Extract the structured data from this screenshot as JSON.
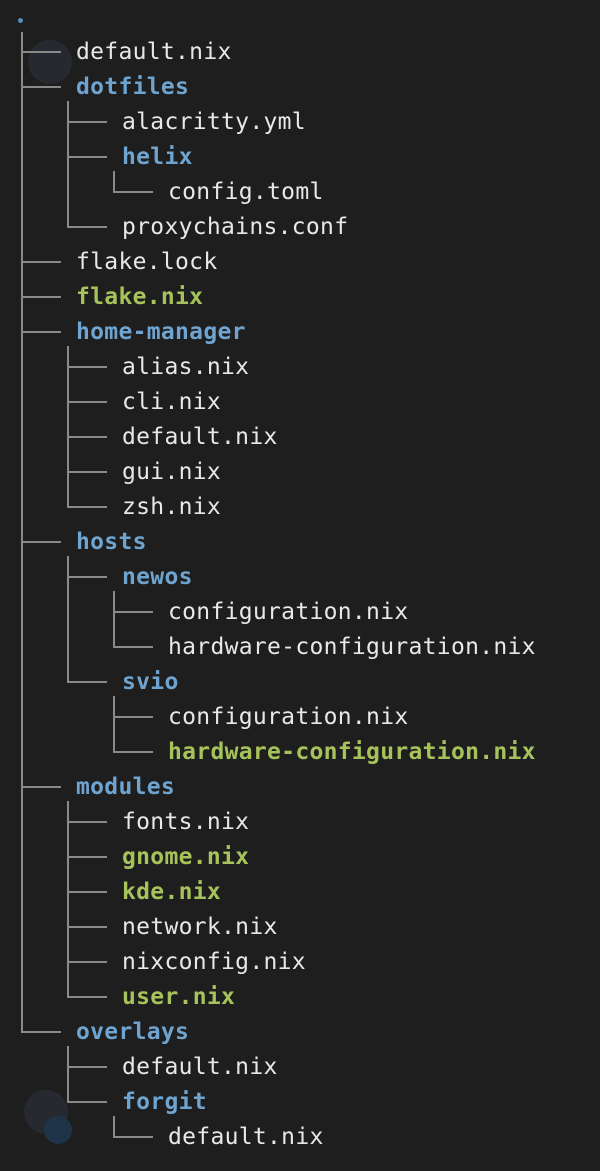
{
  "root": ".",
  "colors": {
    "background": "#1e1e1e",
    "file": "#e8e8e8",
    "directory": "#6ea4cf",
    "modified": "#a6c25a",
    "branch": "#8a8a8a"
  },
  "tree": [
    {
      "name": "default.nix",
      "type": "file"
    },
    {
      "name": "dotfiles",
      "type": "dir",
      "children": [
        {
          "name": "alacritty.yml",
          "type": "file"
        },
        {
          "name": "helix",
          "type": "dir",
          "children": [
            {
              "name": "config.toml",
              "type": "file"
            }
          ]
        },
        {
          "name": "proxychains.conf",
          "type": "file"
        }
      ]
    },
    {
      "name": "flake.lock",
      "type": "file"
    },
    {
      "name": "flake.nix",
      "type": "mod"
    },
    {
      "name": "home-manager",
      "type": "dir",
      "children": [
        {
          "name": "alias.nix",
          "type": "file"
        },
        {
          "name": "cli.nix",
          "type": "file"
        },
        {
          "name": "default.nix",
          "type": "file"
        },
        {
          "name": "gui.nix",
          "type": "file"
        },
        {
          "name": "zsh.nix",
          "type": "file"
        }
      ]
    },
    {
      "name": "hosts",
      "type": "dir",
      "children": [
        {
          "name": "newos",
          "type": "dir",
          "children": [
            {
              "name": "configuration.nix",
              "type": "file"
            },
            {
              "name": "hardware-configuration.nix",
              "type": "file"
            }
          ]
        },
        {
          "name": "svio",
          "type": "dir",
          "children": [
            {
              "name": "configuration.nix",
              "type": "file"
            },
            {
              "name": "hardware-configuration.nix",
              "type": "mod"
            }
          ]
        }
      ]
    },
    {
      "name": "modules",
      "type": "dir",
      "children": [
        {
          "name": "fonts.nix",
          "type": "file"
        },
        {
          "name": "gnome.nix",
          "type": "mod"
        },
        {
          "name": "kde.nix",
          "type": "mod"
        },
        {
          "name": "network.nix",
          "type": "file"
        },
        {
          "name": "nixconfig.nix",
          "type": "file"
        },
        {
          "name": "user.nix",
          "type": "mod"
        }
      ]
    },
    {
      "name": "overlays",
      "type": "dir",
      "children": [
        {
          "name": "default.nix",
          "type": "file"
        },
        {
          "name": "forgit",
          "type": "dir",
          "children": [
            {
              "name": "default.nix",
              "type": "file"
            }
          ]
        }
      ]
    }
  ]
}
